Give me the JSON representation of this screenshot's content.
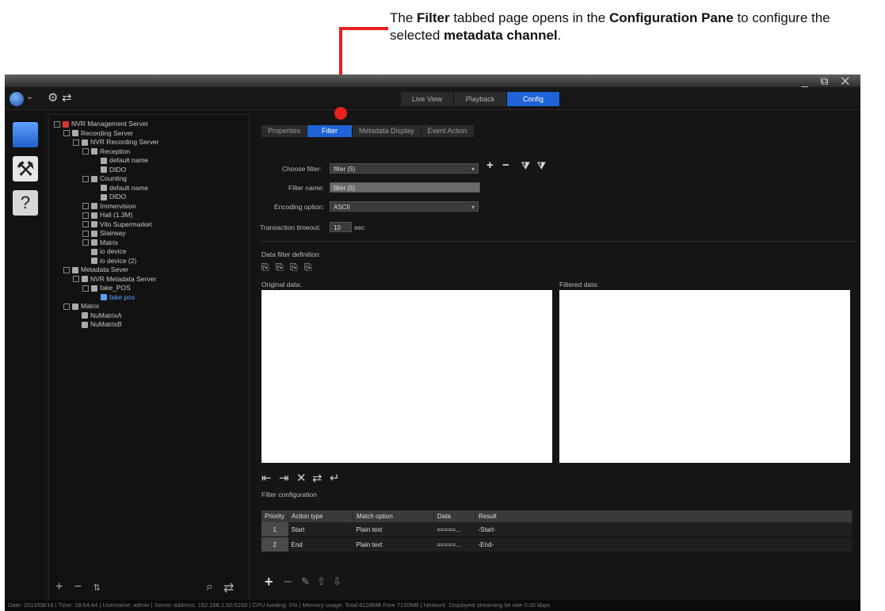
{
  "callout": {
    "p1": "The ",
    "b1": "Filter",
    "p2": " tabbed page opens in the ",
    "b2": "Configuration Pane",
    "p3": " to configure the selected ",
    "b3": "metadata channel",
    "p4": "."
  },
  "colors": {
    "accent": "#1f63d6",
    "callout": "#e8201e"
  },
  "window_controls": "_ ⧉ ✕",
  "modes": [
    "Live View",
    "Playback",
    "Config"
  ],
  "active_mode": "Config",
  "tree": [
    {
      "label": "NVR Management Server",
      "level": 0
    },
    {
      "label": "Recording Server",
      "level": 1
    },
    {
      "label": "NVR Recording Server",
      "level": 2
    },
    {
      "label": "Reception",
      "level": 3
    },
    {
      "label": "default name",
      "level": 4
    },
    {
      "label": "DIDO",
      "level": 4
    },
    {
      "label": "Counting",
      "level": 3
    },
    {
      "label": "default name",
      "level": 4
    },
    {
      "label": "DIDO",
      "level": 4
    },
    {
      "label": "Immervision",
      "level": 3
    },
    {
      "label": "Hall (1.3M)",
      "level": 3
    },
    {
      "label": "Vito Supermarket",
      "level": 3
    },
    {
      "label": "Stairway",
      "level": 3
    },
    {
      "label": "Matrix",
      "level": 3
    },
    {
      "label": "io device",
      "level": 3
    },
    {
      "label": "io device (2)",
      "level": 3
    },
    {
      "label": "Metadata Sever",
      "level": 1
    },
    {
      "label": "NVR Metadata Server",
      "level": 2
    },
    {
      "label": "fake_POS",
      "level": 3
    },
    {
      "label": "fake pos",
      "level": 4,
      "selected": true
    },
    {
      "label": "Matrix",
      "level": 1
    },
    {
      "label": "NuMatrixA",
      "level": 2
    },
    {
      "label": "NuMatrixB",
      "level": 2
    }
  ],
  "tabs": [
    "Properties",
    "Filter",
    "Metadata Display",
    "Event Action"
  ],
  "active_tab": "Filter",
  "form": {
    "choose_filter_label": "Choose filter:",
    "choose_filter_value": "filter (5)",
    "filter_name_label": "Filter name:",
    "filter_name_value": "filter (5)",
    "encoding_label": "Encoding option:",
    "encoding_value": "ASCII",
    "timeout_label": "Transaction timeout:",
    "timeout_value": "10",
    "timeout_unit": "sec"
  },
  "data_filter_definition_label": "Data filter definition:",
  "original_data_label": "Original data:",
  "filtered_data_label": "Filtered data:",
  "filter_configuration_label": "Filter configuration",
  "table": {
    "headers": [
      "Priority",
      "Action type",
      "Match option",
      "Data",
      "Result"
    ],
    "rows": [
      {
        "priority": "1",
        "action": "Start",
        "match": "Plain text",
        "data": "=====...",
        "result": "-Start-"
      },
      {
        "priority": "2",
        "action": "End",
        "match": "Plain text",
        "data": "=====...",
        "result": "-End-"
      }
    ]
  },
  "status": "Date: 2013/08/16 | Time: 18:54:44 | Username: admin | Server address: 192.168.1.50:5250 | CPU loading: 0% | Memory usage: Total 8128MB Free 7130MB | Network: Displayed streaming bit rate 0.00 kbps"
}
